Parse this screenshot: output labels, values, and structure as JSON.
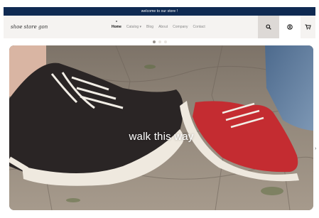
{
  "announcement": {
    "text": "welcome to our store !"
  },
  "header": {
    "logo_text": "shoe store gon",
    "nav": [
      {
        "label": "Home",
        "active": true
      },
      {
        "label": "Catalog ▾",
        "active": false
      },
      {
        "label": "Blog",
        "active": false
      },
      {
        "label": "About",
        "active": false
      },
      {
        "label": "Company",
        "active": false
      },
      {
        "label": "Contact",
        "active": false
      }
    ],
    "icons": {
      "search": "search-icon",
      "account": "user-icon",
      "cart": "cart-icon"
    }
  },
  "slideshow": {
    "slide_count": 3,
    "active_index": 1,
    "caption": "walk this way"
  },
  "colors": {
    "announcement_bg": "#0f2a52",
    "header_bg": "#f5f3f1",
    "search_bg": "#ddd9d6"
  }
}
